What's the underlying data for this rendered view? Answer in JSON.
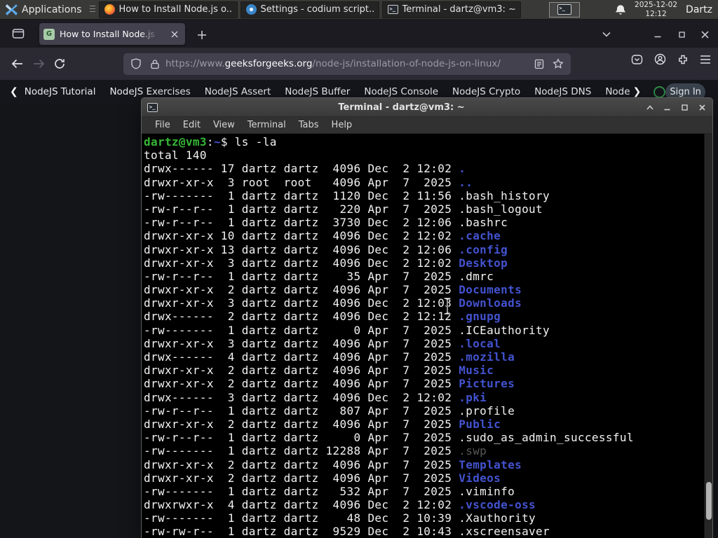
{
  "panel": {
    "applications_label": "Applications",
    "windows": [
      {
        "label": "How to Install Node.js o...",
        "icon": "firefox"
      },
      {
        "label": "Settings - codium script...",
        "icon": "codium"
      },
      {
        "label": "Terminal - dartz@vm3: ~",
        "icon": "terminal"
      }
    ],
    "clock_date": "2025-12-02",
    "clock_time": "12:12",
    "user": "Dartz"
  },
  "browser": {
    "tab_title": "How to Install Node.js on",
    "new_tab_symbol": "+",
    "url_scheme": "https://www.",
    "url_domain": "geeksforgeeks.org",
    "url_path": "/node-js/installation-of-node-js-on-linux/"
  },
  "site_nav": {
    "back_chevron": "❮",
    "forward_chevron": "❯",
    "items": [
      "NodeJS Tutorial",
      "NodeJS Exercises",
      "NodeJS Assert",
      "NodeJS Buffer",
      "NodeJS Console",
      "NodeJS Crypto",
      "NodeJS DNS",
      "Node"
    ],
    "sign_in_label": "Sign In",
    "accent_green": "#2f8d46"
  },
  "terminal": {
    "title": "Terminal - dartz@vm3: ~",
    "menu": [
      "File",
      "Edit",
      "View",
      "Terminal",
      "Tabs",
      "Help"
    ],
    "colors": {
      "bg": "#000000",
      "fg": "#f2f2f2",
      "green": "#35b835",
      "blue": "#4353d0",
      "dim": "#585858"
    },
    "lines": [
      {
        "segments": [
          {
            "t": "dartz@vm3",
            "c": "green"
          },
          {
            "t": ":",
            "c": "fg"
          },
          {
            "t": "~",
            "c": "blue"
          },
          {
            "t": "$ ls -la",
            "c": "fg"
          }
        ]
      },
      {
        "segments": [
          {
            "t": "total 140",
            "c": "fg"
          }
        ]
      },
      {
        "segments": [
          {
            "t": "drwx------ 17 dartz dartz  4096 Dec  2 12:02 ",
            "c": "fg"
          },
          {
            "t": ".",
            "c": "blue"
          }
        ]
      },
      {
        "segments": [
          {
            "t": "drwxr-xr-x  3 root  root   4096 Apr  7  2025 ",
            "c": "fg"
          },
          {
            "t": "..",
            "c": "blue"
          }
        ]
      },
      {
        "segments": [
          {
            "t": "-rw-------  1 dartz dartz  1120 Dec  2 11:56 .bash_history",
            "c": "fg"
          }
        ]
      },
      {
        "segments": [
          {
            "t": "-rw-r--r--  1 dartz dartz   220 Apr  7  2025 .bash_logout",
            "c": "fg"
          }
        ]
      },
      {
        "segments": [
          {
            "t": "-rw-r--r--  1 dartz dartz  3730 Dec  2 12:06 .bashrc",
            "c": "fg"
          }
        ]
      },
      {
        "segments": [
          {
            "t": "drwxr-xr-x 10 dartz dartz  4096 Dec  2 12:02 ",
            "c": "fg"
          },
          {
            "t": ".cache",
            "c": "blue"
          }
        ]
      },
      {
        "segments": [
          {
            "t": "drwxr-xr-x 13 dartz dartz  4096 Dec  2 12:06 ",
            "c": "fg"
          },
          {
            "t": ".config",
            "c": "blue"
          }
        ]
      },
      {
        "segments": [
          {
            "t": "drwxr-xr-x  3 dartz dartz  4096 Dec  2 12:02 ",
            "c": "fg"
          },
          {
            "t": "Desktop",
            "c": "blue"
          }
        ]
      },
      {
        "segments": [
          {
            "t": "-rw-r--r--  1 dartz dartz    35 Apr  7  2025 .dmrc",
            "c": "fg"
          }
        ]
      },
      {
        "segments": [
          {
            "t": "drwxr-xr-x  2 dartz dartz  4096 Apr  7  2025 ",
            "c": "fg"
          },
          {
            "t": "Documents",
            "c": "blue"
          }
        ]
      },
      {
        "segments": [
          {
            "t": "drwxr-xr-x  3 dartz dartz  4096 Dec  2 12:03 ",
            "c": "fg"
          },
          {
            "t": "Downloads",
            "c": "blue"
          }
        ]
      },
      {
        "segments": [
          {
            "t": "drwx------  2 dartz dartz  4096 Dec  2 12:12 ",
            "c": "fg"
          },
          {
            "t": ".gnupg",
            "c": "blue"
          }
        ]
      },
      {
        "segments": [
          {
            "t": "-rw-------  1 dartz dartz     0 Apr  7  2025 .ICEauthority",
            "c": "fg"
          }
        ]
      },
      {
        "segments": [
          {
            "t": "drwxr-xr-x  3 dartz dartz  4096 Apr  7  2025 ",
            "c": "fg"
          },
          {
            "t": ".local",
            "c": "blue"
          }
        ]
      },
      {
        "segments": [
          {
            "t": "drwx------  4 dartz dartz  4096 Apr  7  2025 ",
            "c": "fg"
          },
          {
            "t": ".mozilla",
            "c": "blue"
          }
        ]
      },
      {
        "segments": [
          {
            "t": "drwxr-xr-x  2 dartz dartz  4096 Apr  7  2025 ",
            "c": "fg"
          },
          {
            "t": "Music",
            "c": "blue"
          }
        ]
      },
      {
        "segments": [
          {
            "t": "drwxr-xr-x  2 dartz dartz  4096 Apr  7  2025 ",
            "c": "fg"
          },
          {
            "t": "Pictures",
            "c": "blue"
          }
        ]
      },
      {
        "segments": [
          {
            "t": "drwx------  3 dartz dartz  4096 Dec  2 12:02 ",
            "c": "fg"
          },
          {
            "t": ".pki",
            "c": "blue"
          }
        ]
      },
      {
        "segments": [
          {
            "t": "-rw-r--r--  1 dartz dartz   807 Apr  7  2025 .profile",
            "c": "fg"
          }
        ]
      },
      {
        "segments": [
          {
            "t": "drwxr-xr-x  2 dartz dartz  4096 Apr  7  2025 ",
            "c": "fg"
          },
          {
            "t": "Public",
            "c": "blue"
          }
        ]
      },
      {
        "segments": [
          {
            "t": "-rw-r--r--  1 dartz dartz     0 Apr  7  2025 .sudo_as_admin_successful",
            "c": "fg"
          }
        ]
      },
      {
        "segments": [
          {
            "t": "-rw-------  1 dartz dartz 12288 Apr  7  2025 ",
            "c": "fg"
          },
          {
            "t": ".swp",
            "c": "dim"
          }
        ]
      },
      {
        "segments": [
          {
            "t": "drwxr-xr-x  2 dartz dartz  4096 Apr  7  2025 ",
            "c": "fg"
          },
          {
            "t": "Templates",
            "c": "blue"
          }
        ]
      },
      {
        "segments": [
          {
            "t": "drwxr-xr-x  2 dartz dartz  4096 Apr  7  2025 ",
            "c": "fg"
          },
          {
            "t": "Videos",
            "c": "blue"
          }
        ]
      },
      {
        "segments": [
          {
            "t": "-rw-------  1 dartz dartz   532 Apr  7  2025 .viminfo",
            "c": "fg"
          }
        ]
      },
      {
        "segments": [
          {
            "t": "drwxrwxr-x  4 dartz dartz  4096 Dec  2 12:02 ",
            "c": "fg"
          },
          {
            "t": ".vscode-oss",
            "c": "blue"
          }
        ]
      },
      {
        "segments": [
          {
            "t": "-rw-------  1 dartz dartz    48 Dec  2 10:39 .Xauthority",
            "c": "fg"
          }
        ]
      },
      {
        "segments": [
          {
            "t": "-rw-rw-r--  1 dartz dartz  9529 Dec  2 10:43 .xscreensaver",
            "c": "fg"
          }
        ]
      }
    ]
  }
}
